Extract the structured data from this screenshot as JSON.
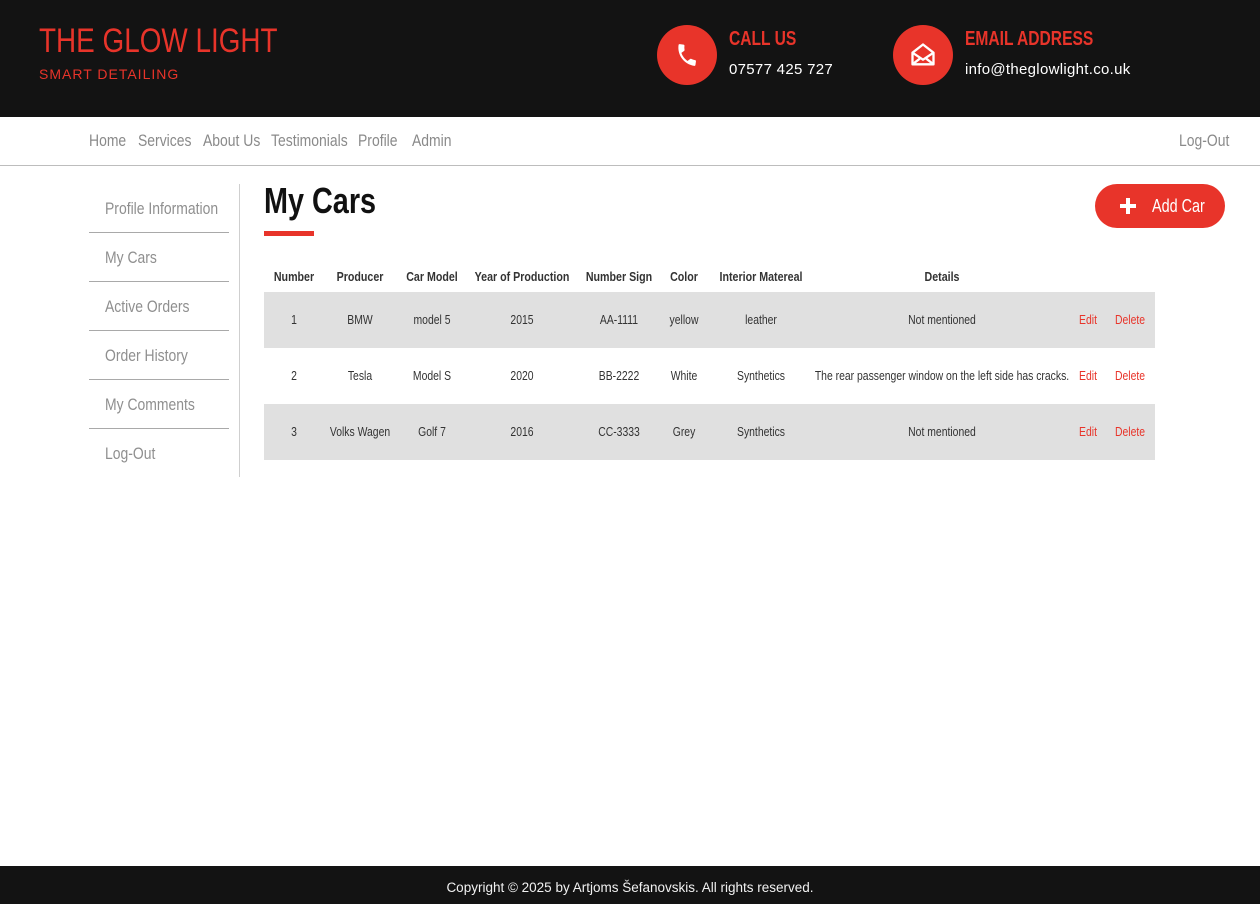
{
  "brand": {
    "title": "THE GLOW LIGHT",
    "subtitle": "SMART DETAILING"
  },
  "contact": {
    "phone": {
      "title": "CALL US",
      "value": "07577 425 727",
      "icon": "phone-icon"
    },
    "email": {
      "title": "EMAIL ADDRESS",
      "value": "info@theglowlight.co.uk",
      "icon": "envelope-open-icon"
    }
  },
  "nav": {
    "items": [
      "Home",
      "Services",
      "About Us",
      "Testimonials",
      "Profile",
      "Admin"
    ],
    "logout": "Log-Out"
  },
  "sidebar": {
    "items": [
      "Profile Information",
      "My Cars",
      "Active Orders",
      "Order History",
      "My Comments",
      "Log-Out"
    ]
  },
  "main": {
    "title": "My Cars",
    "add_button": "Add Car",
    "table": {
      "headers": [
        "Number",
        "Producer",
        "Car Model",
        "Year of Production",
        "Number Sign",
        "Color",
        "Interior Matereal",
        "Details"
      ],
      "rows": [
        [
          "1",
          "BMW",
          "model 5",
          "2015",
          "AA-1111",
          "yellow",
          "leather",
          "Not mentioned"
        ],
        [
          "2",
          "Tesla",
          "Model S",
          "2020",
          "BB-2222",
          "White",
          "Synthetics",
          "The rear passenger window on the left side has cracks."
        ],
        [
          "3",
          "Volks Wagen",
          "Golf 7",
          "2016",
          "CC-3333",
          "Grey",
          "Synthetics",
          "Not mentioned"
        ]
      ],
      "edit_label": "Edit",
      "delete_label": "Delete"
    }
  },
  "footer": {
    "text": "Copyright © 2025 by Artjoms Šefanovskis. All rights reserved."
  },
  "colors": {
    "accent": "#e8342a",
    "header_bg": "#131313",
    "row_shade": "#e0e0e0"
  }
}
